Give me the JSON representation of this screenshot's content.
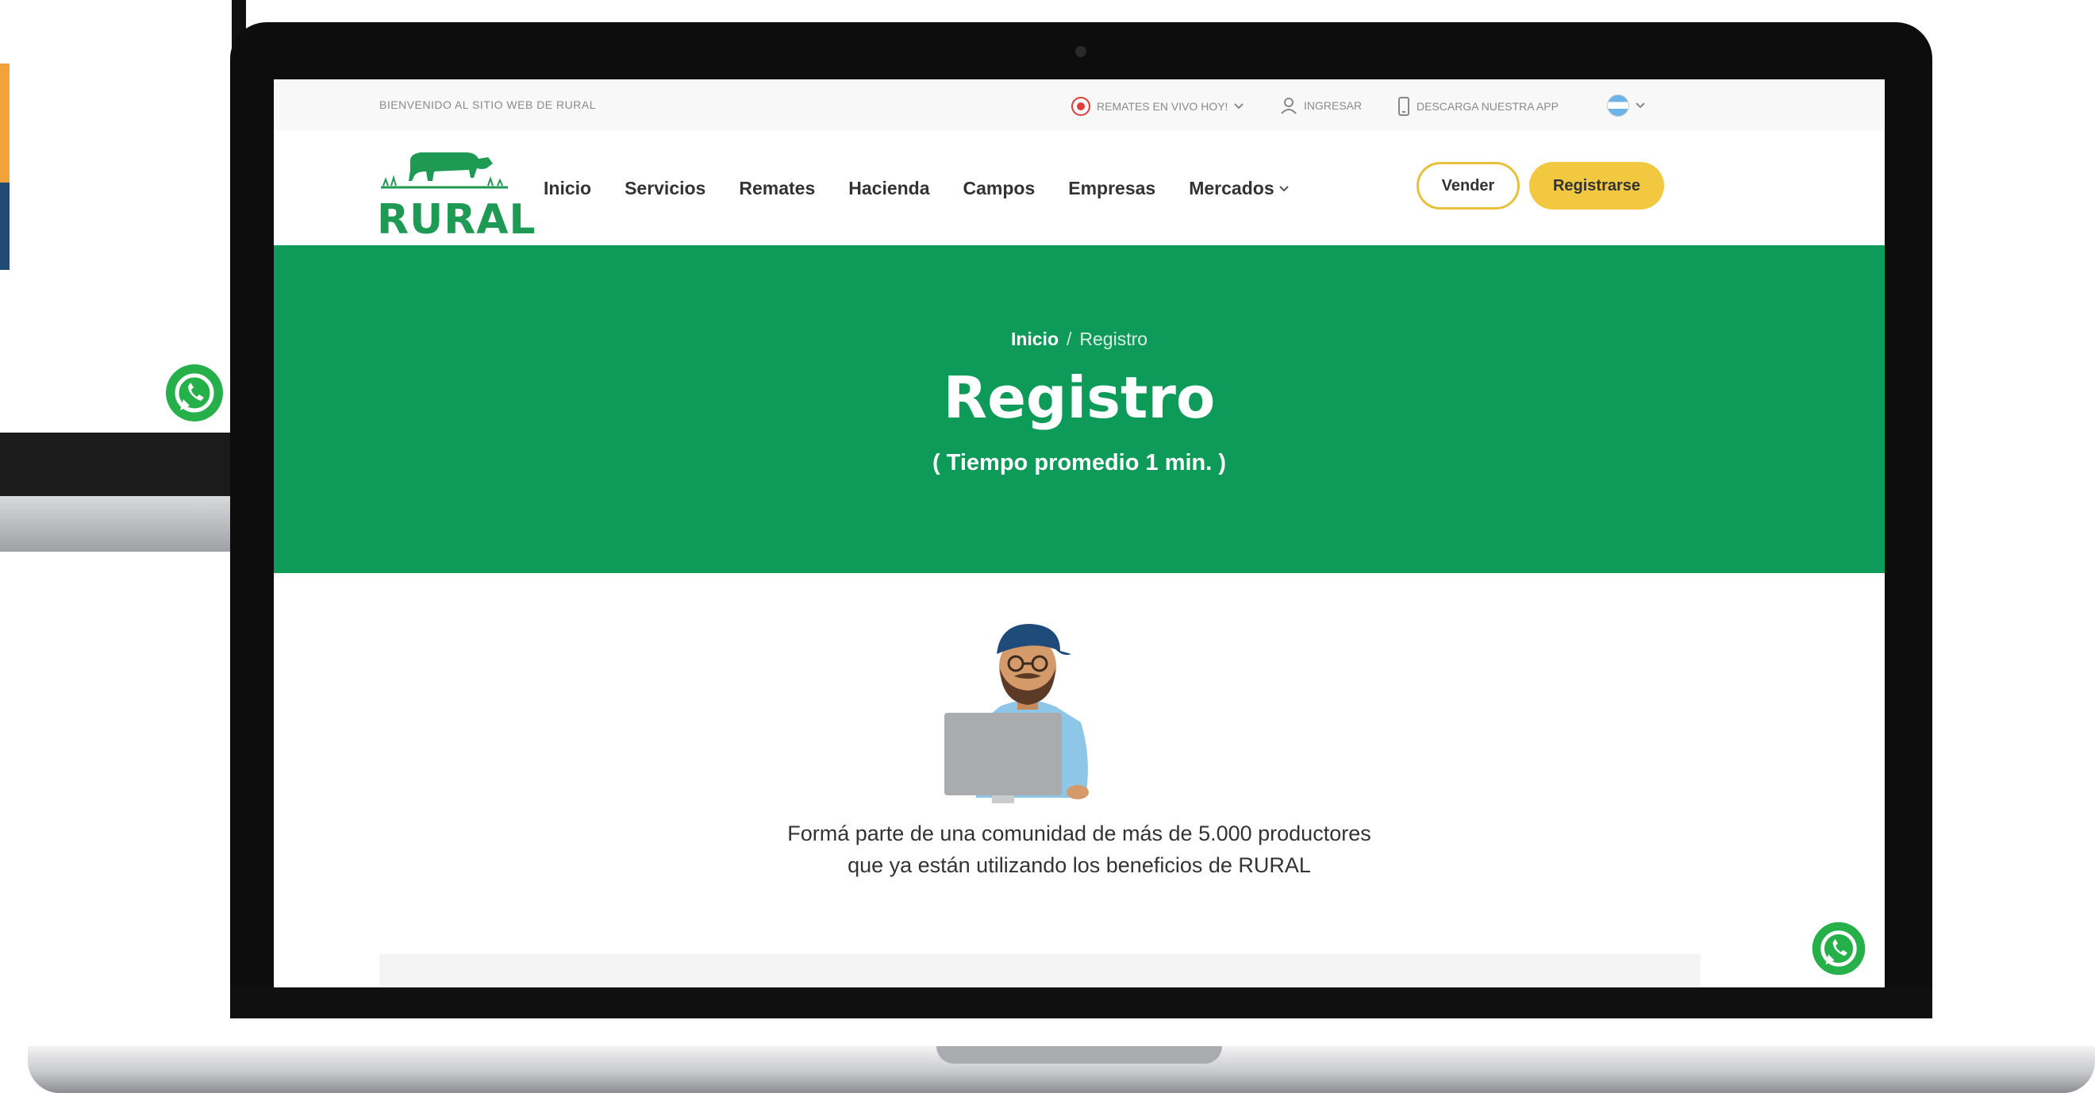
{
  "topbar": {
    "welcome": "BIENVENIDO AL SITIO WEB DE RURAL",
    "live": "REMATES EN VIVO HOY!",
    "login": "INGRESAR",
    "download": "DESCARGA NUESTRA APP"
  },
  "navbar": {
    "logo": "RURAL",
    "links": [
      "Inicio",
      "Servicios",
      "Remates",
      "Hacienda",
      "Campos",
      "Empresas",
      "Mercados"
    ],
    "sell": "Vender",
    "register": "Registrarse"
  },
  "hero": {
    "breadcrumb_home": "Inicio",
    "breadcrumb_sep": "/",
    "breadcrumb_current": "Registro",
    "title": "Registro",
    "subtitle": "( Tiempo promedio 1 min. )"
  },
  "content": {
    "line1": "Formá parte de una comunidad de más de 5.000 productores",
    "line2": "que ya están utilizando los beneficios de RURAL"
  },
  "colors": {
    "brand_green": "#0e9a59",
    "accent_yellow": "#f1c840",
    "live_red": "#e23b3b",
    "whatsapp_green": "#25b04a"
  }
}
